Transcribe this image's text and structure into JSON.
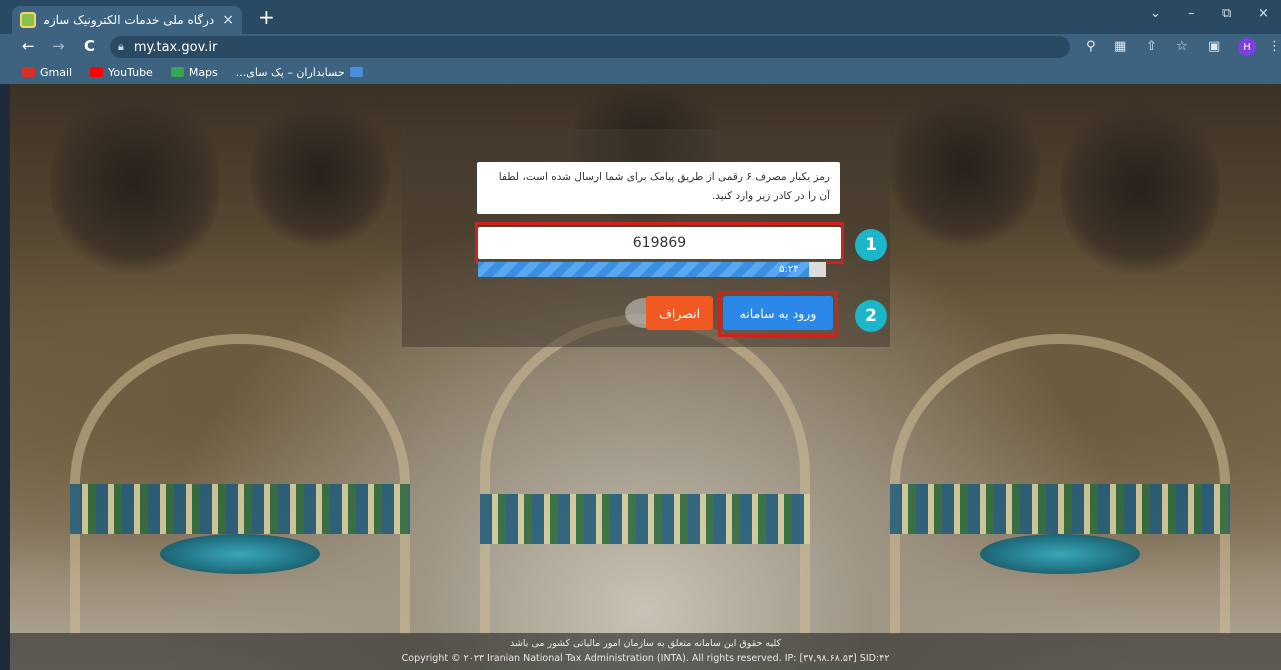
{
  "browser": {
    "tab_title": "درگاه ملی خدمات الکترونیک سازمان",
    "tab_close": "×",
    "new_tab": "+",
    "url": "my.tax.gov.ir",
    "nav": {
      "back": "←",
      "forward": "→",
      "reload": "C"
    },
    "window_controls": {
      "minimize": "–",
      "restore": "⧉",
      "close": "×",
      "collapse": "⌄"
    },
    "profile_initial": "H",
    "bookmarks": [
      {
        "label": "Gmail",
        "color": "#d93025"
      },
      {
        "label": "YouTube",
        "color": "#ff0000"
      },
      {
        "label": "Maps",
        "color": "#34a853"
      },
      {
        "label": "حسابداران – یک سای...",
        "color": "#4a8fd8"
      }
    ]
  },
  "login": {
    "message": "رمز یکبار مصرف ۶ رقمی از طریق پیامک برای شما ارسال شده است، لطفا آن را در کادر زیر وارد کنید.",
    "otp_value": "619869",
    "timer_text": "۵:۲۴",
    "timer_progress_percent": 95,
    "step1": "1",
    "step2": "2",
    "login_button": "ورود به سامانه",
    "cancel_button": "انصراف"
  },
  "footer": {
    "rights_fa": "کلیه حقوق این سامانه متعلق به سازمان امور مالیاتی کشور می باشد",
    "copyright": "Copyright © ۲۰۲۳ Iranian National Tax Administration (INTA). All rights reserved. IP: [۳۷,۹۸.۶۸.۵۳] SID:۴۲"
  },
  "colors": {
    "highlight": "#d4201c",
    "step_badge": "#1bb6c9",
    "login_button": "#2b87e8",
    "cancel_button": "#f05a22"
  }
}
